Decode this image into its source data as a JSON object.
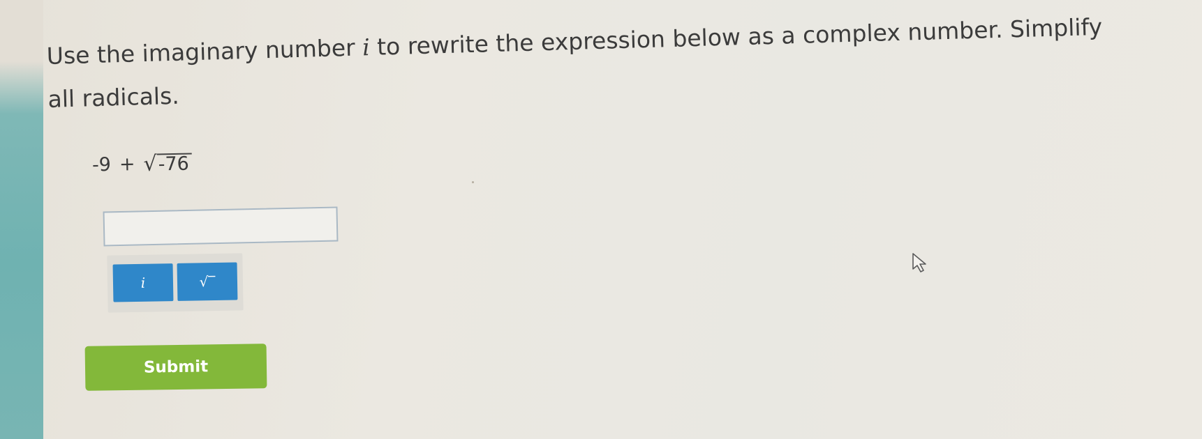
{
  "question": {
    "text_before": "Use the imaginary number ",
    "variable": "i",
    "text_after": " to rewrite the expression below as a complex number. Simplify all radicals."
  },
  "expression": {
    "constant": "-9",
    "operator": "+",
    "radicand": "-76"
  },
  "answer": {
    "value": ""
  },
  "keypad": {
    "imaginary_key": "i",
    "sqrt_key": "√‾"
  },
  "submit": {
    "label": "Submit"
  },
  "colors": {
    "submit_green": "#83b83a",
    "key_blue": "#2f87c9",
    "side_teal": "#6fb2b1"
  },
  "icons": {
    "cursor": "cursor-arrow-icon"
  }
}
